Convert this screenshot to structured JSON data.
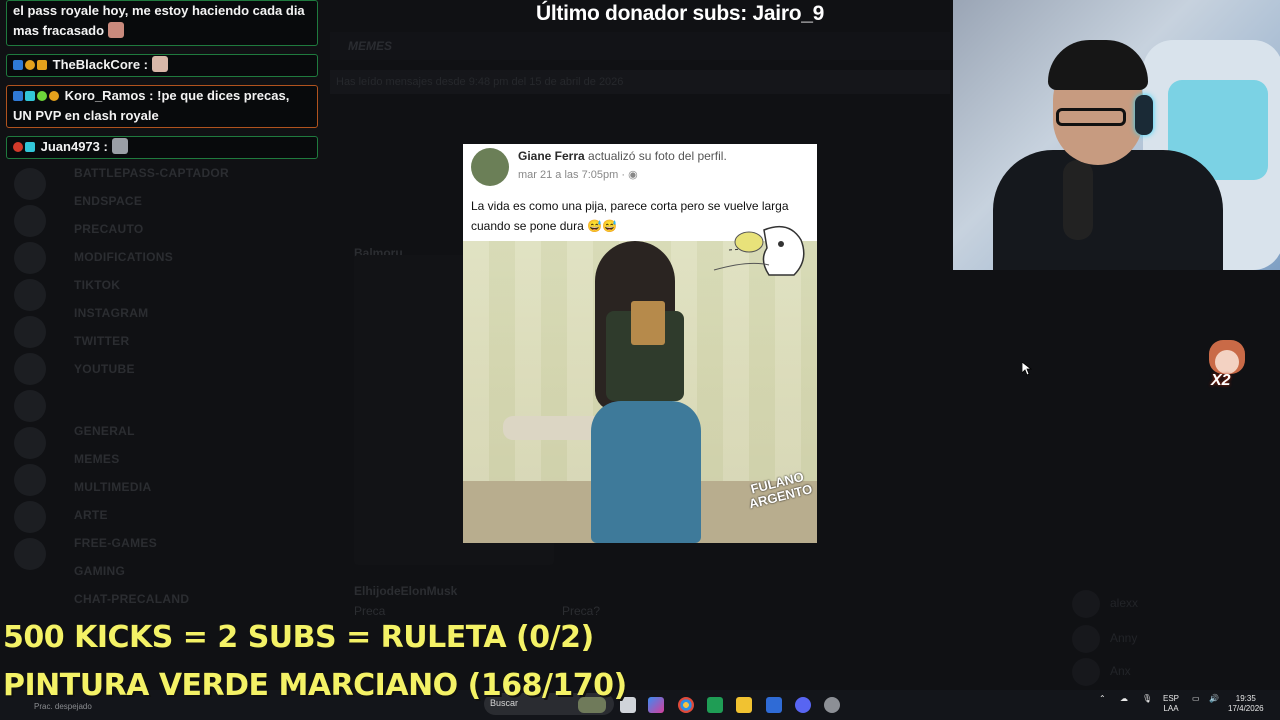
{
  "stream": {
    "donor_text": "Último donador subs: Jairo_9",
    "goal_kicks": "500 KICKS = 2 SUBS = RULETA (0/2)",
    "goal_paint": "PINTURA VERDE MARCIANO (168/170)",
    "sticker_text": "X2"
  },
  "chat": {
    "messages": [
      {
        "user": "",
        "text": "el pass royale hoy, me estoy haciendo cada dia mas fracasado"
      },
      {
        "user": "TheBlackCore :",
        "text": ""
      },
      {
        "user": "Koro_Ramos :",
        "text": "!pe que dices precas, UN PVP en clash royale"
      },
      {
        "user": "Juan4973 :",
        "text": ""
      }
    ]
  },
  "meme": {
    "author": "Giane Ferra",
    "action": "actualizó su foto del perfil.",
    "date": "mar 21 a las 7:05pm · ",
    "caption": "La vida es como una pija, parece corta pero se vuelve larga cuando se pone dura 😅😅",
    "watermark": "FULANO ARGENTO"
  },
  "discord": {
    "channel_title": "MEMES",
    "notice": "Has leído mensajes desde 9:48 pm del 15 de abril de 2026",
    "channels": [
      "BATTLEPASS-CAPTADOR",
      "ENDSPACE",
      "PRECAUTO",
      "MODIFICATIONS",
      "TIKTOK",
      "INSTAGRAM",
      "TWITTER",
      "YOUTUBE",
      "GENERAL",
      "MEMES",
      "MULTIMEDIA",
      "ARTE",
      "FREE-GAMES",
      "GAMING",
      "CHAT-PRECALAND"
    ],
    "author_1": "Balmoru",
    "author_2": "ElhijodeElonMusk",
    "reply_text": "Preca",
    "reply_text_2": "Preca?",
    "members": [
      "alexx",
      "Anny",
      "Anx"
    ]
  },
  "taskbar": {
    "weather": "Prac. despejado",
    "search_placeholder": "Buscar",
    "lang_top": "ESP",
    "lang_bottom": "LAA",
    "time": "19:35",
    "date": "17/4/2026"
  }
}
